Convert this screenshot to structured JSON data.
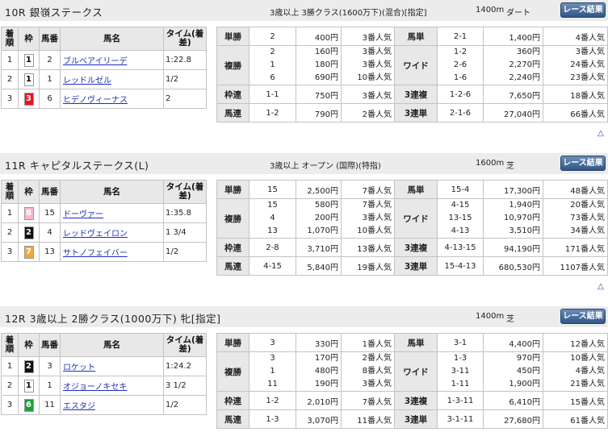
{
  "buttons": {
    "race_label": "レース結果"
  },
  "headers": {
    "finish": "着順",
    "frame": "枠",
    "number": "馬番",
    "horse": "馬名",
    "time": "タイム(着差)"
  },
  "races": [
    {
      "name": "10R 銀嶺ステークス",
      "class": "3歳以上 3勝クラス(1600万下)(混合)[指定]",
      "distance": "1400m",
      "surface": "ダート",
      "results": [
        {
          "pos": "1",
          "frame": "1",
          "frame_color": "#ffffff",
          "frame_text": "#000000",
          "num": "2",
          "horse": "ブルベアイリーデ",
          "time": "1:22.8"
        },
        {
          "pos": "2",
          "frame": "1",
          "frame_color": "#ffffff",
          "frame_text": "#000000",
          "num": "1",
          "horse": "レッドルゼル",
          "time": "1/2"
        },
        {
          "pos": "3",
          "frame": "3",
          "frame_color": "#e8141c",
          "frame_text": "#ffffff",
          "num": "6",
          "horse": "ヒデノヴィーナス",
          "time": "2"
        }
      ],
      "payouts": {
        "tansho": {
          "label": "単勝",
          "num": "2",
          "amt": "400円",
          "pop": "3番人気"
        },
        "fukusho": {
          "label": "複勝",
          "nums": [
            "2",
            "1",
            "6"
          ],
          "amts": [
            "160円",
            "180円",
            "690円"
          ],
          "pops": [
            "3番人気",
            "3番人気",
            "10番人気"
          ]
        },
        "wakuren": {
          "label": "枠連",
          "num": "1-1",
          "amt": "750円",
          "pop": "3番人気"
        },
        "umaren": {
          "label": "馬連",
          "num": "1-2",
          "amt": "790円",
          "pop": "2番人気"
        },
        "umatan": {
          "label": "馬単",
          "num": "2-1",
          "amt": "1,400円",
          "pop": "4番人気"
        },
        "wide": {
          "label": "ワイド",
          "nums": [
            "1-2",
            "2-6",
            "1-6"
          ],
          "amts": [
            "360円",
            "2,270円",
            "2,240円"
          ],
          "pops": [
            "3番人気",
            "24番人気",
            "23番人気"
          ]
        },
        "sanrenpuku": {
          "label": "3連複",
          "num": "1-2-6",
          "amt": "7,650円",
          "pop": "18番人気"
        },
        "sanrentan": {
          "label": "3連単",
          "num": "2-1-6",
          "amt": "27,040円",
          "pop": "66番人気"
        }
      }
    },
    {
      "name": "11R キャピタルステークス(L)",
      "class": "3歳以上 オープン (国際)(特指)",
      "distance": "1600m",
      "surface": "芝",
      "results": [
        {
          "pos": "1",
          "frame": "8",
          "frame_color": "#f7b8cc",
          "frame_text": "#ffffff",
          "num": "15",
          "horse": "ドーヴァー",
          "time": "1:35.8"
        },
        {
          "pos": "2",
          "frame": "2",
          "frame_color": "#111111",
          "frame_text": "#ffffff",
          "num": "4",
          "horse": "レッドヴェイロン",
          "time": "1 3/4"
        },
        {
          "pos": "3",
          "frame": "7",
          "frame_color": "#f5a53c",
          "frame_text": "#ffffff",
          "num": "13",
          "horse": "サトノフェイバー",
          "time": "1/2"
        }
      ],
      "payouts": {
        "tansho": {
          "label": "単勝",
          "num": "15",
          "amt": "2,500円",
          "pop": "7番人気"
        },
        "fukusho": {
          "label": "複勝",
          "nums": [
            "15",
            "4",
            "13"
          ],
          "amts": [
            "580円",
            "200円",
            "1,070円"
          ],
          "pops": [
            "7番人気",
            "3番人気",
            "10番人気"
          ]
        },
        "wakuren": {
          "label": "枠連",
          "num": "2-8",
          "amt": "3,710円",
          "pop": "13番人気"
        },
        "umaren": {
          "label": "馬連",
          "num": "4-15",
          "amt": "5,840円",
          "pop": "19番人気"
        },
        "umatan": {
          "label": "馬単",
          "num": "15-4",
          "amt": "17,300円",
          "pop": "48番人気"
        },
        "wide": {
          "label": "ワイド",
          "nums": [
            "4-15",
            "13-15",
            "4-13"
          ],
          "amts": [
            "1,940円",
            "10,970円",
            "3,510円"
          ],
          "pops": [
            "20番人気",
            "73番人気",
            "34番人気"
          ]
        },
        "sanrenpuku": {
          "label": "3連複",
          "num": "4-13-15",
          "amt": "94,190円",
          "pop": "171番人気"
        },
        "sanrentan": {
          "label": "3連単",
          "num": "15-4-13",
          "amt": "680,530円",
          "pop": "1107番人気"
        }
      }
    },
    {
      "name": "12R 3歳以上 2勝クラス(1000万下) 牝[指定]",
      "class": "",
      "distance": "1400m",
      "surface": "芝",
      "results": [
        {
          "pos": "1",
          "frame": "2",
          "frame_color": "#111111",
          "frame_text": "#ffffff",
          "num": "3",
          "horse": "ロケット",
          "time": "1:24.2"
        },
        {
          "pos": "2",
          "frame": "1",
          "frame_color": "#ffffff",
          "frame_text": "#000000",
          "num": "1",
          "horse": "オジョーノキセキ",
          "time": "3 1/2"
        },
        {
          "pos": "3",
          "frame": "6",
          "frame_color": "#1aa03c",
          "frame_text": "#ffffff",
          "num": "11",
          "horse": "エスタジ",
          "time": "1/2"
        }
      ],
      "payouts": {
        "tansho": {
          "label": "単勝",
          "num": "3",
          "amt": "330円",
          "pop": "1番人気"
        },
        "fukusho": {
          "label": "複勝",
          "nums": [
            "3",
            "1",
            "11"
          ],
          "amts": [
            "170円",
            "480円",
            "190円"
          ],
          "pops": [
            "2番人気",
            "8番人気",
            "3番人気"
          ]
        },
        "wakuren": {
          "label": "枠連",
          "num": "1-2",
          "amt": "2,010円",
          "pop": "7番人気"
        },
        "umaren": {
          "label": "馬連",
          "num": "1-3",
          "amt": "3,070円",
          "pop": "11番人気"
        },
        "umatan": {
          "label": "馬単",
          "num": "3-1",
          "amt": "4,400円",
          "pop": "12番人気"
        },
        "wide": {
          "label": "ワイド",
          "nums": [
            "1-3",
            "3-11",
            "1-11"
          ],
          "amts": [
            "970円",
            "450円",
            "1,900円"
          ],
          "pops": [
            "10番人気",
            "4番人気",
            "21番人気"
          ]
        },
        "sanrenpuku": {
          "label": "3連複",
          "num": "1-3-11",
          "amt": "6,410円",
          "pop": "15番人気"
        },
        "sanrentan": {
          "label": "3連単",
          "num": "3-1-11",
          "amt": "27,680円",
          "pop": "61番人気"
        }
      }
    }
  ]
}
